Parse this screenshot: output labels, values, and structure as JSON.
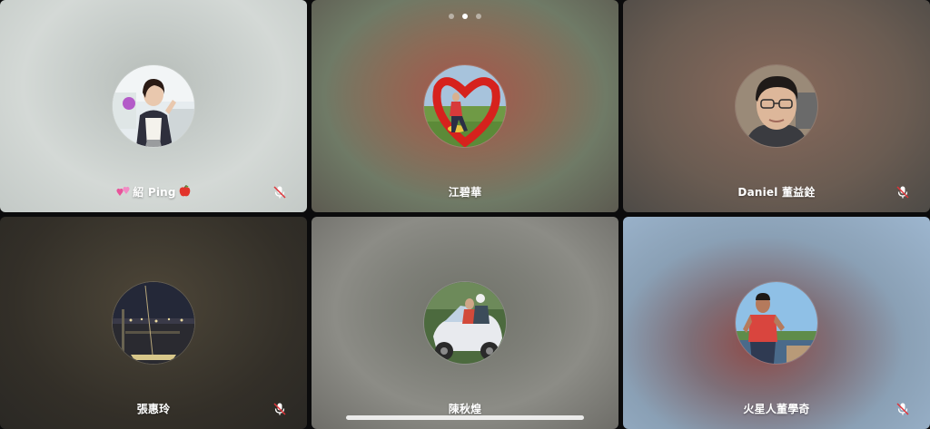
{
  "pagination": {
    "total": 3,
    "current": 2
  },
  "participants": [
    {
      "name": "紹 Ping",
      "prefix_emoji": "two-hearts",
      "suffix_emoji": "apple",
      "muted": true,
      "avatar": "woman-thumbs-up-photo"
    },
    {
      "name": "江碧華",
      "muted": false,
      "avatar": "person-in-red-heart-sculpture-photo"
    },
    {
      "name": "Daniel 董益銓",
      "muted": true,
      "avatar": "man-with-glasses-photo"
    },
    {
      "name": "張惠玲",
      "muted": true,
      "avatar": "night-cityscape-photo"
    },
    {
      "name": "陳秋煌",
      "muted": false,
      "avatar": "couple-on-motorcycle-photo"
    },
    {
      "name": "火星人董學奇",
      "muted": true,
      "avatar": "man-red-shirt-photo"
    }
  ],
  "colors": {
    "text": "#ffffff",
    "mic_muted": "#ffffff"
  }
}
